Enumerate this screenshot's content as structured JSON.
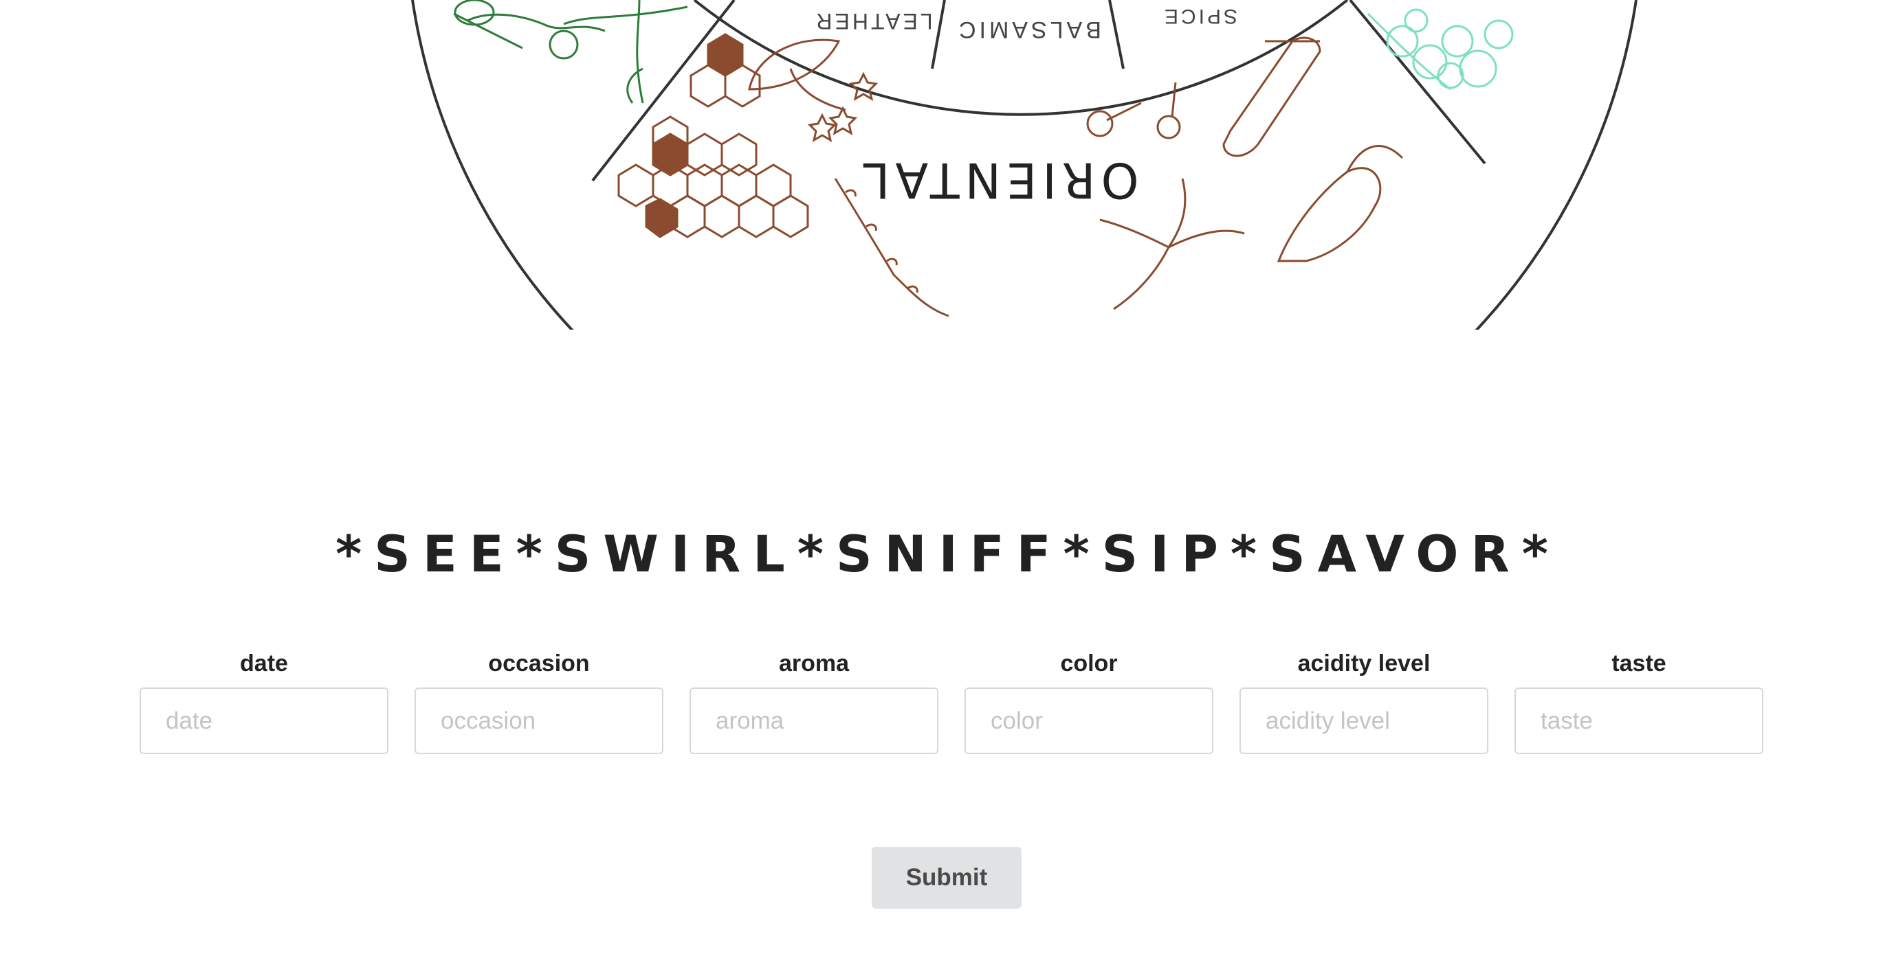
{
  "wheel": {
    "labels": [
      "LEATHER",
      "BALSAMIC",
      "SPICE",
      "ORIENTAL"
    ],
    "colors": {
      "outline": "#333333",
      "brown": "#8a4b2e",
      "green": "#2e7d3a",
      "mint": "#7fe0c0"
    }
  },
  "headline": "*SEE*SWIRL*SNIFF*SIP*SAVOR*",
  "form": {
    "fields": [
      {
        "label": "date",
        "placeholder": "date"
      },
      {
        "label": "occasion",
        "placeholder": "occasion"
      },
      {
        "label": "aroma",
        "placeholder": "aroma"
      },
      {
        "label": "color",
        "placeholder": "color"
      },
      {
        "label": "acidity level",
        "placeholder": "acidity level"
      },
      {
        "label": "taste",
        "placeholder": "taste"
      }
    ],
    "submit_label": "Submit"
  }
}
